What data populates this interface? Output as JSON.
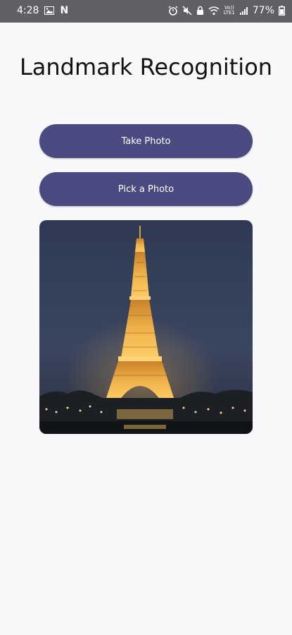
{
  "status_bar": {
    "time": "4:28",
    "netflix": "N",
    "volte_line1": "Vo))",
    "volte_line2": "LTE1",
    "battery": "77%"
  },
  "app": {
    "title": "Landmark Recognition",
    "take_photo_label": "Take Photo",
    "pick_photo_label": "Pick a Photo"
  },
  "colors": {
    "button": "#4a4a80",
    "background": "#f8f8fa",
    "status_bar": "#5f5f64"
  }
}
